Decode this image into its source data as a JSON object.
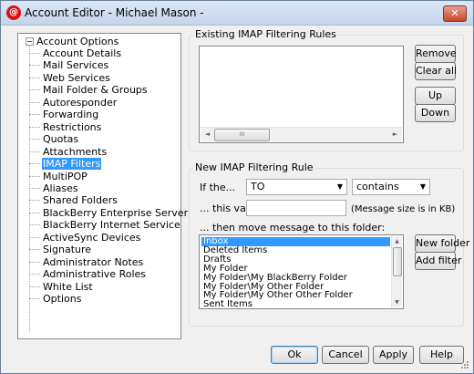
{
  "window": {
    "title": "Account Editor - Michael Mason -",
    "close_glyph": "✕",
    "app_icon_glyph": "@"
  },
  "tree": {
    "root_label": "Account Options",
    "expander_glyph": "−",
    "items": [
      {
        "label": "Account Details",
        "selected": false
      },
      {
        "label": "Mail Services",
        "selected": false
      },
      {
        "label": "Web Services",
        "selected": false
      },
      {
        "label": "Mail Folder & Groups",
        "selected": false
      },
      {
        "label": "Autoresponder",
        "selected": false
      },
      {
        "label": "Forwarding",
        "selected": false
      },
      {
        "label": "Restrictions",
        "selected": false
      },
      {
        "label": "Quotas",
        "selected": false
      },
      {
        "label": "Attachments",
        "selected": false
      },
      {
        "label": "IMAP Filters",
        "selected": true
      },
      {
        "label": "MultiPOP",
        "selected": false
      },
      {
        "label": "Aliases",
        "selected": false
      },
      {
        "label": "Shared Folders",
        "selected": false
      },
      {
        "label": "BlackBerry Enterprise Server",
        "selected": false
      },
      {
        "label": "BlackBerry Internet Service",
        "selected": false
      },
      {
        "label": "ActiveSync Devices",
        "selected": false
      },
      {
        "label": "Signature",
        "selected": false
      },
      {
        "label": "Administrator Notes",
        "selected": false
      },
      {
        "label": "Administrative Roles",
        "selected": false
      },
      {
        "label": "White List",
        "selected": false
      },
      {
        "label": "Options",
        "selected": false
      }
    ]
  },
  "existing_rules": {
    "group_title": "Existing IMAP Filtering Rules",
    "rules": [],
    "scroll_left_glyph": "◄",
    "scroll_right_glyph": "►",
    "thumb_grip": "III",
    "buttons": {
      "remove": "Remove",
      "clear_all": "Clear all",
      "up": "Up",
      "down": "Down"
    }
  },
  "new_rule": {
    "group_title": "New IMAP Filtering Rule",
    "if_label": "If the...",
    "field_value": "TO",
    "operator_value": "contains",
    "dropdown_glyph": "▼",
    "value_label": "... this value:",
    "value_input": "",
    "value_hint": "(Message size is in KB)",
    "move_label": "... then move message to this folder:",
    "folders": [
      {
        "label": "Inbox",
        "selected": true
      },
      {
        "label": "Deleted Items",
        "selected": false
      },
      {
        "label": "Drafts",
        "selected": false
      },
      {
        "label": "My Folder",
        "selected": false
      },
      {
        "label": "My Folder\\My BlackBerry Folder",
        "selected": false
      },
      {
        "label": "My Folder\\My Other Folder",
        "selected": false
      },
      {
        "label": "My Folder\\My Other Other Folder",
        "selected": false
      },
      {
        "label": "Sent Items",
        "selected": false
      }
    ],
    "scroll_up_glyph": "▲",
    "scroll_down_glyph": "▼",
    "buttons": {
      "new_folder": "New folder",
      "add_filter": "Add filter"
    }
  },
  "footer": {
    "ok": "Ok",
    "cancel": "Cancel",
    "apply": "Apply",
    "help": "Help"
  }
}
